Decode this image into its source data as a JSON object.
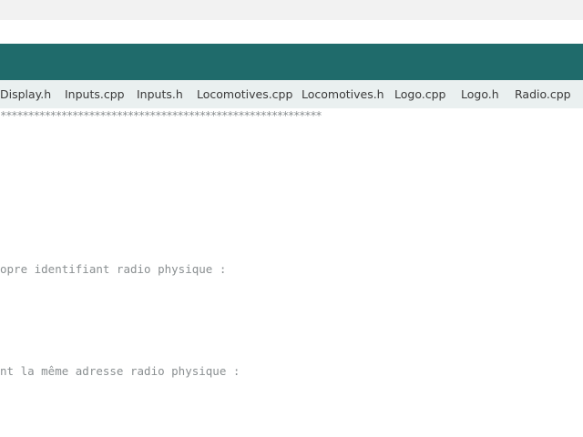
{
  "tabs": [
    {
      "label": "Display.h"
    },
    {
      "label": "Inputs.cpp"
    },
    {
      "label": "Inputs.h"
    },
    {
      "label": "Locomotives.cpp"
    },
    {
      "label": "Locomotives.h"
    },
    {
      "label": "Logo.cpp"
    },
    {
      "label": "Logo.h"
    },
    {
      "label": "Radio.cpp"
    }
  ],
  "code": {
    "stars_line": "**********************************************************",
    "line_identifier": "opre identifiant radio physique :",
    "line_address": "nt la même adresse radio physique :"
  },
  "colors": {
    "header": "#1f6b6b",
    "tab_bar": "#eaf0f0",
    "code_text": "#8a8f91"
  }
}
